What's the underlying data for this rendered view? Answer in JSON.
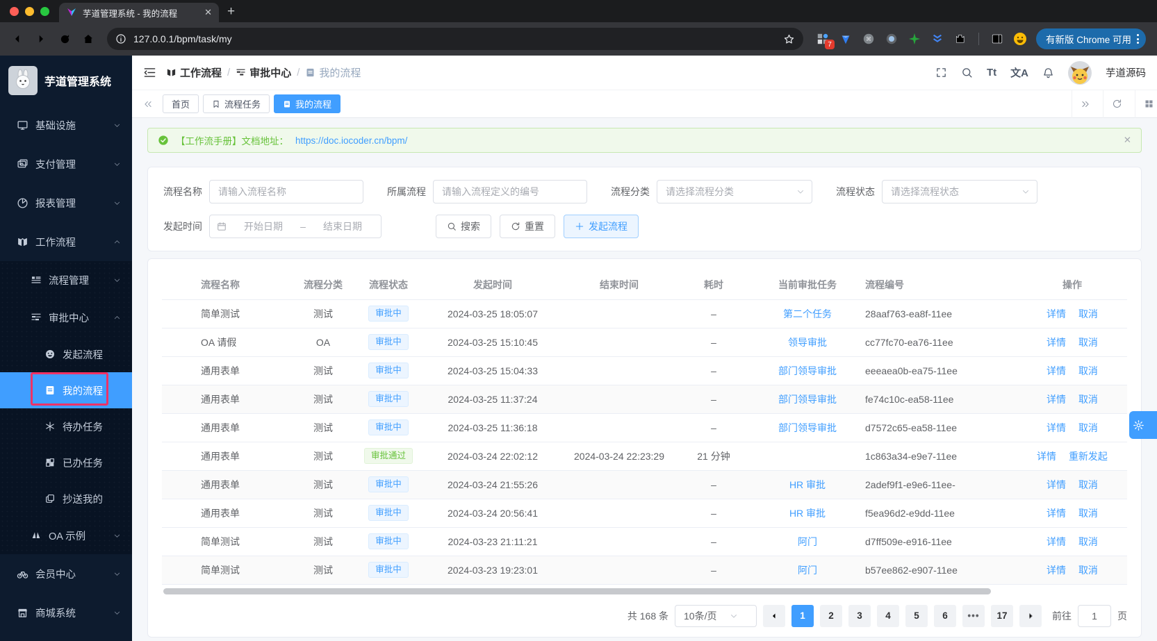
{
  "colors": {
    "accent": "#409eff",
    "success": "#67c23a",
    "sidebar_bg": "#0d1b2e",
    "annotation": "#ee3266"
  },
  "browser": {
    "tab_title": "芋道管理系统 - 我的流程",
    "url": "127.0.0.1/bpm/task/my",
    "extension_badge": "7",
    "update_pill": "有新版 Chrome 可用"
  },
  "sidebar": {
    "app_title": "芋道管理系统",
    "menu": [
      {
        "label": "基础设施"
      },
      {
        "label": "支付管理"
      },
      {
        "label": "报表管理"
      },
      {
        "label": "工作流程"
      },
      {
        "label": "流程管理"
      },
      {
        "label": "审批中心"
      },
      {
        "label": "发起流程"
      },
      {
        "label": "我的流程"
      },
      {
        "label": "待办任务"
      },
      {
        "label": "已办任务"
      },
      {
        "label": "抄送我的"
      },
      {
        "label": "OA 示例"
      },
      {
        "label": "会员中心"
      },
      {
        "label": "商城系统"
      }
    ]
  },
  "header": {
    "breadcrumb": [
      "工作流程",
      "审批中心",
      "我的流程"
    ],
    "separator": "/",
    "font_icon": "Tt",
    "locale_icon": "文A",
    "username": "芋道源码"
  },
  "tags": {
    "items": [
      "首页",
      "流程任务",
      "我的流程"
    ],
    "active": "我的流程"
  },
  "alert": {
    "text": "【工作流手册】文档地址：",
    "link": "https://doc.iocoder.cn/bpm/"
  },
  "filters": {
    "name_label": "流程名称",
    "name_placeholder": "请输入流程名称",
    "def_label": "所属流程",
    "def_placeholder": "请输入流程定义的编号",
    "category_label": "流程分类",
    "category_placeholder": "请选择流程分类",
    "status_label": "流程状态",
    "status_placeholder": "请选择流程状态",
    "time_label": "发起时间",
    "start_placeholder": "开始日期",
    "range_separator": "–",
    "end_placeholder": "结束日期",
    "search_label": "搜索",
    "reset_label": "重置",
    "create_label": "发起流程"
  },
  "table": {
    "columns": [
      "流程名称",
      "流程分类",
      "流程状态",
      "发起时间",
      "结束时间",
      "耗时",
      "当前审批任务",
      "流程编号",
      "操作"
    ],
    "rows": [
      {
        "name": "简单测试",
        "category": "测试",
        "status": "审批中",
        "status_kind": "running",
        "start": "2024-03-25 18:05:07",
        "end": "",
        "duration": "–",
        "task": "第二个任务",
        "pid": "28aaf763-ea8f-11ee",
        "a1": "详情",
        "a2": "取消",
        "shade": false
      },
      {
        "name": "OA 请假",
        "category": "OA",
        "status": "审批中",
        "status_kind": "running",
        "start": "2024-03-25 15:10:45",
        "end": "",
        "duration": "–",
        "task": "领导审批",
        "pid": "cc77fc70-ea76-11ee",
        "a1": "详情",
        "a2": "取消",
        "shade": false
      },
      {
        "name": "通用表单",
        "category": "测试",
        "status": "审批中",
        "status_kind": "running",
        "start": "2024-03-25 15:04:33",
        "end": "",
        "duration": "–",
        "task": "部门领导审批",
        "pid": "eeeaea0b-ea75-11ee",
        "a1": "详情",
        "a2": "取消",
        "shade": false
      },
      {
        "name": "通用表单",
        "category": "测试",
        "status": "审批中",
        "status_kind": "running",
        "start": "2024-03-25 11:37:24",
        "end": "",
        "duration": "–",
        "task": "部门领导审批",
        "pid": "fe74c10c-ea58-11ee",
        "a1": "详情",
        "a2": "取消",
        "shade": true
      },
      {
        "name": "通用表单",
        "category": "测试",
        "status": "审批中",
        "status_kind": "running",
        "start": "2024-03-25 11:36:18",
        "end": "",
        "duration": "–",
        "task": "部门领导审批",
        "pid": "d7572c65-ea58-11ee",
        "a1": "详情",
        "a2": "取消",
        "shade": false
      },
      {
        "name": "通用表单",
        "category": "测试",
        "status": "审批通过",
        "status_kind": "success",
        "start": "2024-03-24 22:02:12",
        "end": "2024-03-24 22:23:29",
        "duration": "21 分钟",
        "task": "",
        "pid": "1c863a34-e9e7-11ee",
        "a1": "详情",
        "a2": "重新发起",
        "shade": false
      },
      {
        "name": "通用表单",
        "category": "测试",
        "status": "审批中",
        "status_kind": "running",
        "start": "2024-03-24 21:55:26",
        "end": "",
        "duration": "–",
        "task": "HR 审批",
        "pid": "2adef9f1-e9e6-11ee-",
        "a1": "详情",
        "a2": "取消",
        "shade": true
      },
      {
        "name": "通用表单",
        "category": "测试",
        "status": "审批中",
        "status_kind": "running",
        "start": "2024-03-24 20:56:41",
        "end": "",
        "duration": "–",
        "task": "HR 审批",
        "pid": "f5ea96d2-e9dd-11ee",
        "a1": "详情",
        "a2": "取消",
        "shade": false
      },
      {
        "name": "简单测试",
        "category": "测试",
        "status": "审批中",
        "status_kind": "running",
        "start": "2024-03-23 21:11:21",
        "end": "",
        "duration": "–",
        "task": "阿门",
        "pid": "d7ff509e-e916-11ee",
        "a1": "详情",
        "a2": "取消",
        "shade": false
      },
      {
        "name": "简单测试",
        "category": "测试",
        "status": "审批中",
        "status_kind": "running",
        "start": "2024-03-23 19:23:01",
        "end": "",
        "duration": "–",
        "task": "阿门",
        "pid": "b57ee862-e907-11ee",
        "a1": "详情",
        "a2": "取消",
        "shade": true
      }
    ]
  },
  "pagination": {
    "total": "共 168 条",
    "page_size": "10条/页",
    "pages": [
      "1",
      "2",
      "3",
      "4",
      "5",
      "6",
      "•••",
      "17"
    ],
    "active": "1",
    "goto_prefix": "前往",
    "goto_value": "1",
    "goto_suffix": "页"
  }
}
